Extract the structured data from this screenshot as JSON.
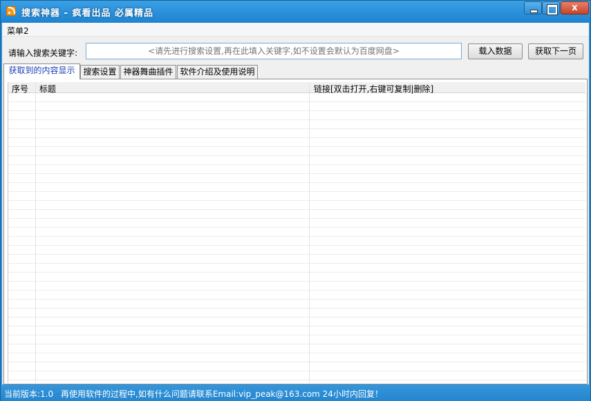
{
  "window": {
    "title": "搜索神器 - 疯看出品 必属精品",
    "close_glyph": "x"
  },
  "menu": {
    "items": [
      "菜单2"
    ]
  },
  "search": {
    "label": "请输入搜索关键字:",
    "placeholder": "<请先进行搜索设置,再在此填入关键字,如不设置会默认为百度网盘>",
    "value": ""
  },
  "buttons": {
    "load": "载入数据",
    "next_page": "获取下一页"
  },
  "tabs": [
    {
      "label": "获取到的内容显示",
      "active": true
    },
    {
      "label": "搜索设置",
      "active": false
    },
    {
      "label": "神器舞曲插件",
      "active": false
    },
    {
      "label": "软件介绍及使用说明",
      "active": false
    }
  ],
  "table": {
    "columns": [
      "序号",
      "标题",
      "链接[双击打开,右键可复制|删除]"
    ],
    "rows": []
  },
  "status": {
    "version": "当前版本:1.0",
    "message": "再使用软件的过程中,如有什么问题请联系Email:vip_peak@163.com 24小时内回复！"
  },
  "colors": {
    "title_bar": "#2c8ed6",
    "status_bar": "#2586cf",
    "active_tab_text": "#1a3fb5",
    "input_text": "#1a1aa6"
  }
}
